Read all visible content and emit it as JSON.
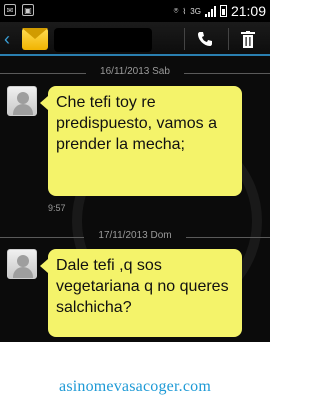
{
  "status_bar": {
    "network_label": "3G",
    "time": "21:09",
    "icons": [
      "mail-notification-icon",
      "image-notification-icon",
      "vibrate-icon",
      "wifi-icon",
      "signal-icon",
      "battery-icon"
    ]
  },
  "action_bar": {
    "back_icon": "back-arrow-icon",
    "contact_icon": "envelope-icon",
    "call_icon": "phone-icon",
    "delete_icon": "trash-icon"
  },
  "conversation": [
    {
      "date": "16/11/2013 Sab",
      "message": "Che tefi toy re predispuesto, vamos a prender la mecha;",
      "time": "9:57"
    },
    {
      "date": "17/11/2013 Dom",
      "message": "Dale tefi ,q sos vegetariana q no queres salchicha?",
      "time": ""
    }
  ],
  "footer": {
    "site": "asinomevasacoger.com"
  },
  "colors": {
    "bubble": "#f4f36a",
    "accent": "#3aa0d8",
    "chat_bg": "#0b0b0b",
    "footer_text": "#1e9ad6"
  }
}
